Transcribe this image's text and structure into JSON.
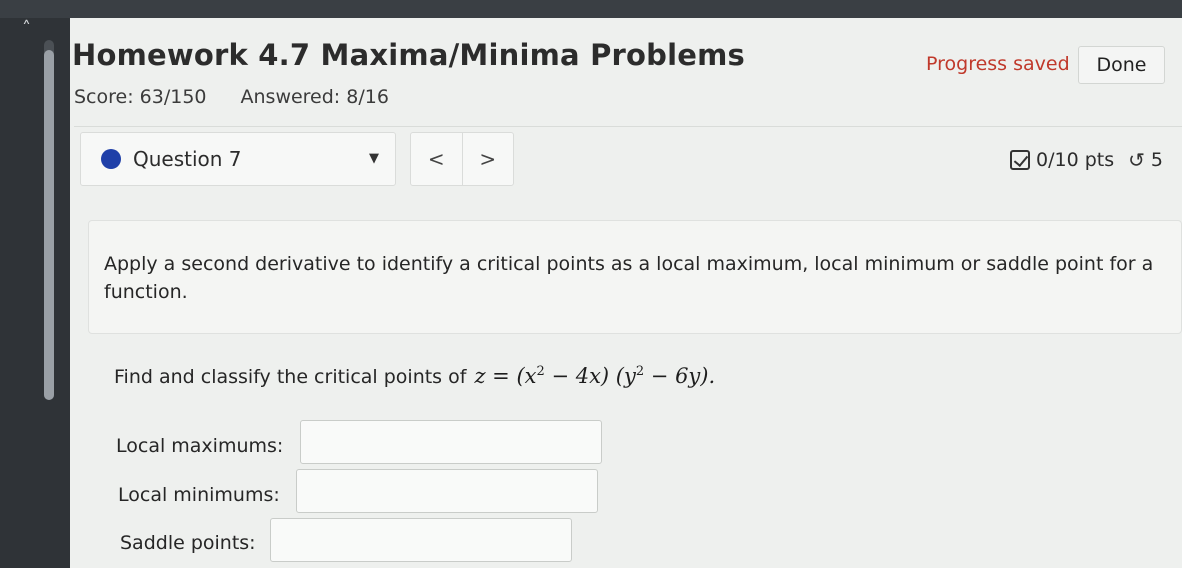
{
  "header": {
    "title": "Homework 4.7 Maxima/Minima Problems",
    "score": "Score: 63/150",
    "answered": "Answered: 8/16",
    "progress_status": "Progress saved",
    "done_label": "Done"
  },
  "question_nav": {
    "selected": "Question 7",
    "prev_label": "<",
    "next_label": ">",
    "points": "0/10 pts",
    "attempts": "5"
  },
  "question": {
    "intro": "Apply a second derivative to identify a critical points as a local maximum, local minimum or saddle point for a function.",
    "prompt": "Find and classify the critical points of",
    "function_lhs": "z = (x",
    "function_mid": " − 4x) (y",
    "function_rhs": " − 6y).",
    "exp": "2"
  },
  "answers": {
    "max_label": "Local maximums:",
    "max_value": "",
    "min_label": "Local minimums:",
    "min_value": "",
    "saddle_label": "Saddle points:",
    "saddle_value": ""
  },
  "colors": {
    "accent": "#1f3fa8",
    "progress": "#c0392b"
  },
  "icons": {
    "collapse": "chevron-up-icon",
    "check": "checkbox-icon",
    "retry": "retry-icon",
    "dropdown": "caret-down-icon"
  }
}
